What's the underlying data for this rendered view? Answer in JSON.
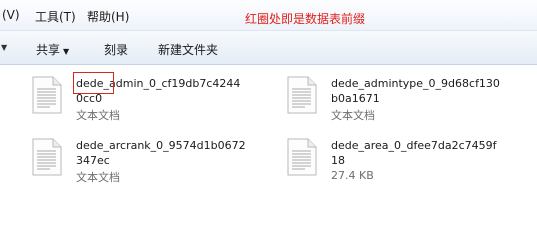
{
  "menu": {
    "items": [
      {
        "label": "(V)"
      },
      {
        "label": "工具(T)"
      },
      {
        "label": "帮助(H)"
      }
    ],
    "annotation": "红圈处即是数据表前缀"
  },
  "toolbar": {
    "share_label": "共享",
    "burn_label": "刻录",
    "new_folder_label": "新建文件夹"
  },
  "files": [
    {
      "name": "dede_admin_0_cf19db7c42440cc0",
      "type": "文本文档"
    },
    {
      "name": "dede_admintype_0_9d68cf130b0a1671",
      "type": "文本文档"
    },
    {
      "name": "dede_arcrank_0_9574d1b0672347ec",
      "type": "文本文档"
    },
    {
      "name": "dede_area_0_dfee7da2c7459f18",
      "type": "27.4 KB"
    }
  ],
  "icons": {
    "file": "text-document-icon"
  }
}
